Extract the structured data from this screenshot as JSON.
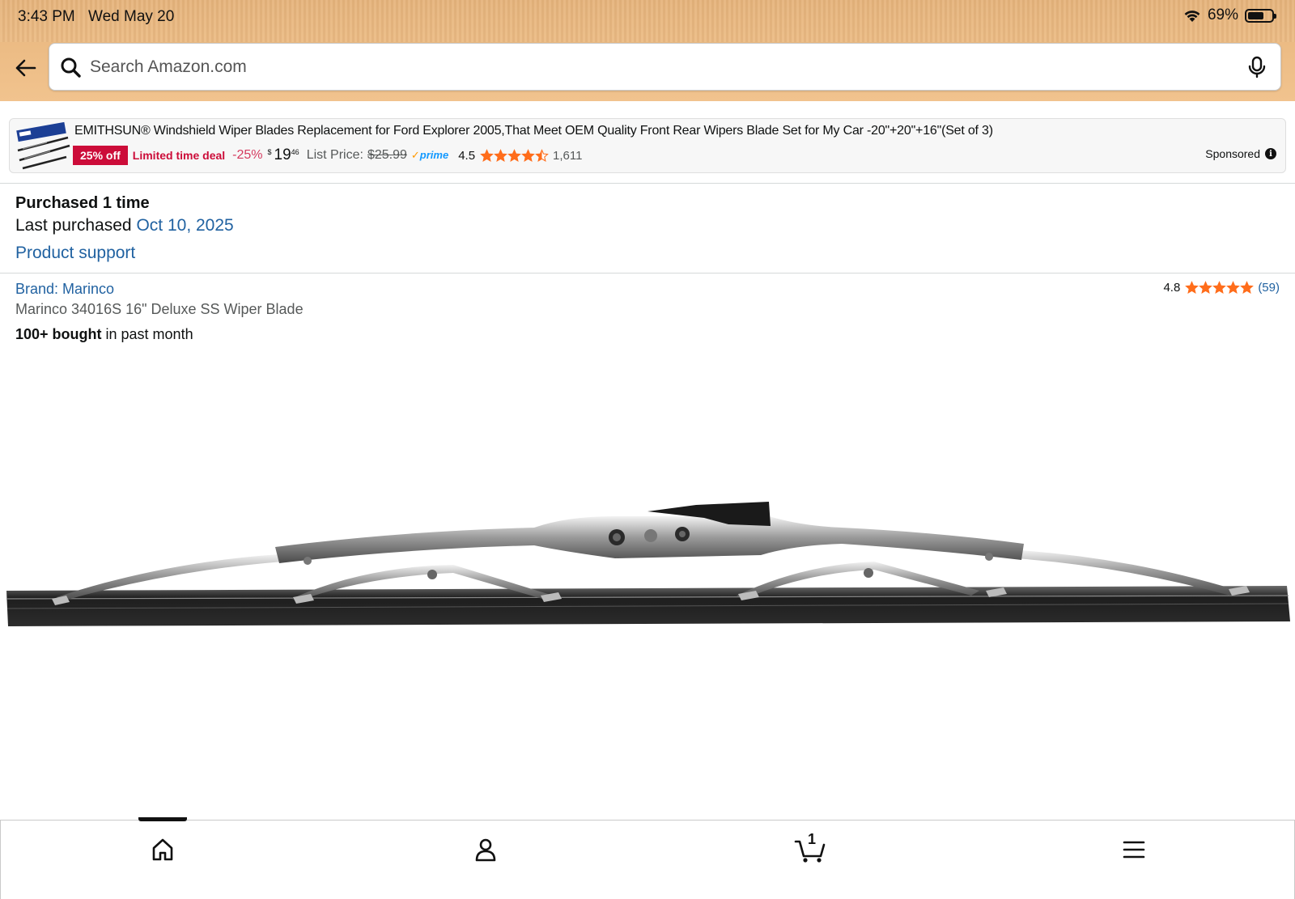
{
  "status_bar": {
    "time": "3:43 PM",
    "date": "Wed May 20",
    "battery": "69%",
    "battery_level": 0.69
  },
  "search": {
    "placeholder": "Search Amazon.com",
    "value": ""
  },
  "sponsored_ad": {
    "title": "EMITHSUN® Windshield Wiper Blades Replacement for Ford Explorer 2005,That Meet OEM Quality Front Rear Wipers Blade Set for My Car -20\"+20\"+16\"(Set of 3)",
    "badge": "25% off",
    "deal_label": "Limited time deal",
    "discount": "-25%",
    "price_symbol": "$",
    "price_whole": "19",
    "price_fraction": "46",
    "list_price_label": "List Price:",
    "list_price": "$25.99",
    "prime_check": "✓",
    "prime_label": "prime",
    "rating": "4.5",
    "stars": 4.5,
    "review_count": "1,611",
    "sponsored_label": "Sponsored",
    "info_glyph": "i",
    "accent_color": "#cc0c39"
  },
  "purchase_info": {
    "purchased_times": "Purchased 1 time",
    "last_purchased_label": "Last purchased",
    "last_purchased_date": "Oct 10, 2025",
    "support_link": "Product support"
  },
  "product": {
    "brand": "Brand: Marinco",
    "title": "Marinco 34016S 16\" Deluxe SS Wiper Blade",
    "bought_bold": "100+ bought",
    "bought_rest": " in past month",
    "rating": "4.8",
    "stars": 5,
    "review_count": "(59)",
    "image_icon": "wiper-blade-image"
  },
  "bottom_nav": {
    "active": "home",
    "items": [
      {
        "name": "home",
        "icon": "home-icon"
      },
      {
        "name": "account",
        "icon": "user-icon"
      },
      {
        "name": "cart",
        "icon": "cart-icon",
        "count": "1"
      },
      {
        "name": "menu",
        "icon": "hamburger-icon"
      }
    ]
  },
  "colors": {
    "header": "#edbd86",
    "link": "#2162a1",
    "star": "#ff6d1b",
    "deal_red": "#cc0c39"
  }
}
